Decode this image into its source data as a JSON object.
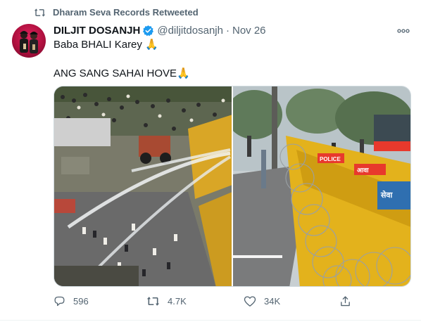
{
  "retweet": {
    "label": "Dharam Seva Records Retweeted",
    "icon": "retweet-icon"
  },
  "author": {
    "display_name": "DILJIT DOSANJH",
    "handle": "@diljitdosanjh",
    "separator": "·",
    "date": "Nov 26",
    "verified": true,
    "avatar": "profile-photo"
  },
  "body": {
    "line1": "Baba BHALI Karey 🙏",
    "line2": "ANG SANG SAHAI HOVE🙏"
  },
  "media": [
    {
      "name": "photo-water-cannon-protest",
      "description_icon": "photo"
    },
    {
      "name": "photo-barricades-barbed-wire",
      "description_icon": "photo",
      "signs": [
        "POLICE",
        "आवा",
        "सेवा"
      ]
    }
  ],
  "actions": {
    "reply_count": "596",
    "retweet_count": "4.7K",
    "like_count": "34K"
  },
  "colors": {
    "secondary_text": "#536471",
    "verified_blue": "#1d9bf0",
    "border": "#cfd9de"
  }
}
